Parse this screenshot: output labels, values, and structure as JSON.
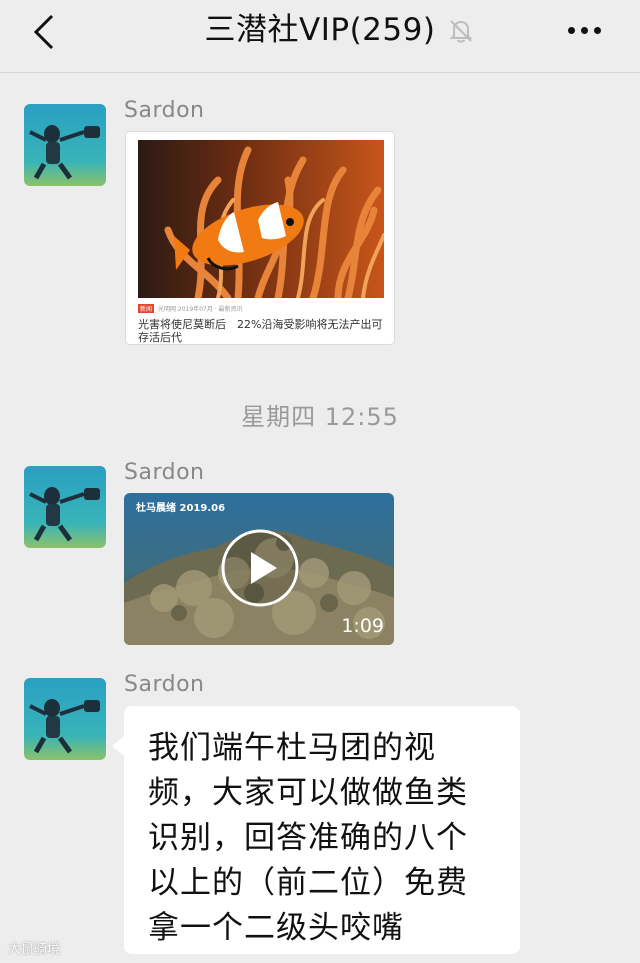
{
  "header": {
    "title": "三潜社VIP(259)",
    "back_icon": "chevron-left-icon",
    "mute_icon": "bell-slash-icon",
    "more_icon": "ellipsis-icon"
  },
  "messages": [
    {
      "sender": "Sardon",
      "type": "article",
      "article": {
        "meta": "光明网 2019年07月 · 最新资讯",
        "headline": "光害将使尼莫断后　22%沿海受影响将无法产出可存活后代"
      }
    },
    {
      "sender": "Sardon",
      "type": "video",
      "video": {
        "label": "杜马晨绪 2019.06",
        "duration": "1:09"
      }
    },
    {
      "sender": "Sardon",
      "type": "text",
      "text": "我们端午杜马团的视频，大家可以做做鱼类识别，回答准确的八个以上的（前二位）免费拿一个二级头咬嘴"
    }
  ],
  "timestamp": "星期四 12:55",
  "watermark": "大鼠骑境"
}
